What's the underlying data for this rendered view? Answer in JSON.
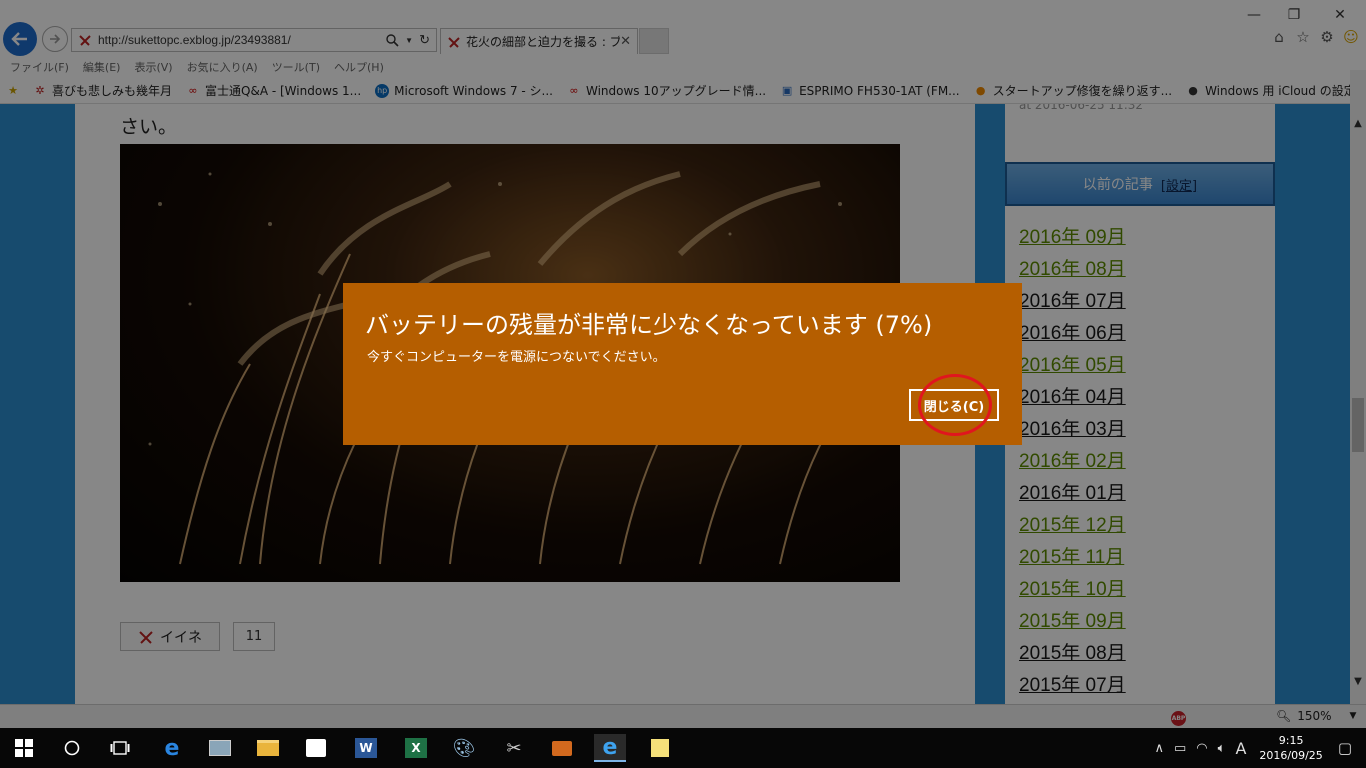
{
  "browser": {
    "url": "http://sukettopc.exblog.jp/23493881/",
    "tab_title": "花火の細部と迫力を撮る : ブ...",
    "menu": [
      "ファイル(F)",
      "編集(E)",
      "表示(V)",
      "お気に入り(A)",
      "ツール(T)",
      "ヘルプ(H)"
    ],
    "favorites": [
      {
        "label": "喜びも悲しみも幾年月",
        "icon": "exblog-icon"
      },
      {
        "label": "富士通Q&A - [Windows 1...",
        "icon": "fujitsu-icon"
      },
      {
        "label": "Microsoft Windows 7 - シ...",
        "icon": "hp-icon"
      },
      {
        "label": "Windows 10アップグレード情...",
        "icon": "fujitsu-icon"
      },
      {
        "label": "ESPRIMO FH530-1AT (FM...",
        "icon": "page-icon"
      },
      {
        "label": "スタートアップ修復を繰り返す...",
        "icon": "orange-icon"
      },
      {
        "label": "Windows 用 iCloud の設定...",
        "icon": "apple-icon"
      }
    ],
    "zoom": "150%"
  },
  "article": {
    "tail_text": "さい。",
    "like_label": "イイネ",
    "like_count": "11"
  },
  "sidebar": {
    "timestamp": "at 2016-06-25 11:32",
    "header": "以前の記事",
    "header_link": "[設定]",
    "archive": [
      {
        "label": "2016年 09月",
        "visited": false
      },
      {
        "label": "2016年 08月",
        "visited": false
      },
      {
        "label": "2016年 07月",
        "visited": true
      },
      {
        "label": "2016年 06月",
        "visited": true
      },
      {
        "label": "2016年 05月",
        "visited": false
      },
      {
        "label": "2016年 04月",
        "visited": true
      },
      {
        "label": "2016年 03月",
        "visited": true
      },
      {
        "label": "2016年 02月",
        "visited": false
      },
      {
        "label": "2016年 01月",
        "visited": true
      },
      {
        "label": "2015年 12月",
        "visited": false
      },
      {
        "label": "2015年 11月",
        "visited": false
      },
      {
        "label": "2015年 10月",
        "visited": false
      },
      {
        "label": "2015年 09月",
        "visited": false
      },
      {
        "label": "2015年 08月",
        "visited": true
      },
      {
        "label": "2015年 07月",
        "visited": true
      }
    ]
  },
  "toast": {
    "title": "バッテリーの残量が非常に少なくなっています (7%)",
    "message": "今すぐコンピューターを電源につないでください。",
    "close_label": "閉じる(C)",
    "battery_percent": 7,
    "background_color": "#b55e00"
  },
  "taskbar": {
    "time": "9:15",
    "date": "2016/09/25",
    "ime": "A"
  }
}
